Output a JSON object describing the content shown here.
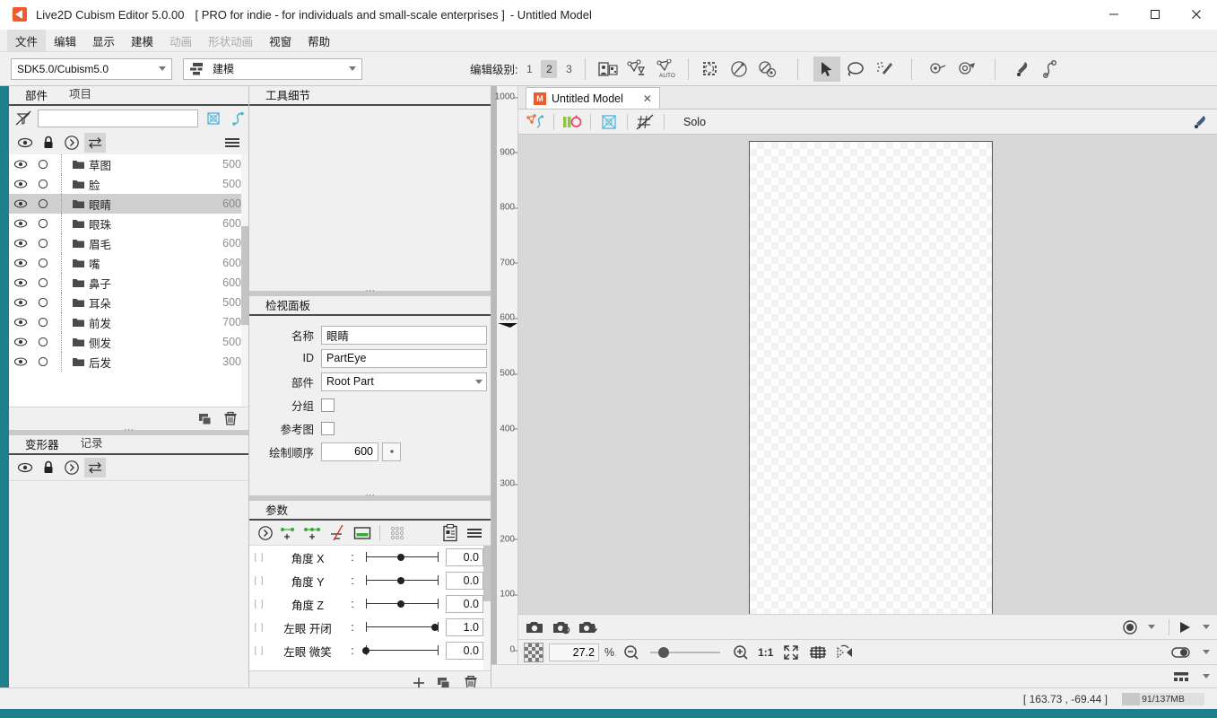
{
  "window": {
    "app_title": "Live2D Cubism Editor 5.0.00",
    "license": "[ PRO for indie - for individuals and small-scale enterprises ]",
    "document_title": "- Untitled Model",
    "minimize": "–",
    "maximize": "☐",
    "close": "✕"
  },
  "menubar": {
    "items": [
      {
        "label": "文件",
        "state": "selected"
      },
      {
        "label": "编辑",
        "state": "normal"
      },
      {
        "label": "显示",
        "state": "normal"
      },
      {
        "label": "建模",
        "state": "normal"
      },
      {
        "label": "动画",
        "state": "disabled"
      },
      {
        "label": "形状动画",
        "state": "disabled"
      },
      {
        "label": "视窗",
        "state": "normal"
      },
      {
        "label": "帮助",
        "state": "normal"
      }
    ]
  },
  "toolbar": {
    "sdk_combo_value": "SDK5.0/Cubism5.0",
    "mode_combo_value": "建模",
    "edit_level_label": "编辑级别:",
    "edit_levels": [
      "1",
      "2",
      "3"
    ],
    "edit_level_active": "2",
    "icons": [
      "texture-atlas-icon",
      "mesh-pen-icon",
      "mesh-auto-icon",
      "select-mesh-icon",
      "brush-select-icon",
      "glue-icon",
      "arrow-select-icon",
      "lasso-icon",
      "deform-brush-icon",
      "rotate-deformer-icon",
      "warp-deformer-icon",
      "art-path-icon",
      "glue-link-icon"
    ]
  },
  "parts_panel": {
    "tabs": [
      {
        "label": "部件",
        "active": true
      },
      {
        "label": "项目",
        "active": false
      }
    ],
    "search_placeholder": "",
    "search_value": "",
    "toolbar_icons": [
      "filter-off-icon",
      "mesh-icon",
      "glue-icon",
      "clip-icon",
      "target-icon",
      "art-path-icon"
    ],
    "filter_icons": [
      "eye-icon",
      "lock-icon",
      "expand-icon",
      "sync-icon"
    ],
    "menu_icon": "hamburger-icon",
    "rows": [
      {
        "name": "草图",
        "order": "500",
        "selected": false
      },
      {
        "name": "脸",
        "order": "500",
        "selected": false
      },
      {
        "name": "眼睛",
        "order": "600",
        "selected": true
      },
      {
        "name": "眼珠",
        "order": "600",
        "selected": false
      },
      {
        "name": "眉毛",
        "order": "600",
        "selected": false
      },
      {
        "name": "嘴",
        "order": "600",
        "selected": false
      },
      {
        "name": "鼻子",
        "order": "600",
        "selected": false
      },
      {
        "name": "耳朵",
        "order": "500",
        "selected": false
      },
      {
        "name": "前发",
        "order": "700",
        "selected": false
      },
      {
        "name": "侧发",
        "order": "500",
        "selected": false
      },
      {
        "name": "后发",
        "order": "300",
        "selected": false
      }
    ],
    "footer_icons": [
      "duplicate-icon",
      "delete-icon"
    ]
  },
  "deformer_panel": {
    "tabs": [
      {
        "label": "变形器",
        "active": true
      },
      {
        "label": "记录",
        "active": false
      }
    ],
    "filter_icons": [
      "eye-icon",
      "lock-icon",
      "expand-icon",
      "sync-icon"
    ]
  },
  "tool_detail": {
    "tabs": [
      {
        "label": "工具细节",
        "active": true
      }
    ]
  },
  "inspector": {
    "tabs": [
      {
        "label": "检视面板",
        "active": true
      }
    ],
    "fields": [
      {
        "label": "名称",
        "type": "text",
        "value": "眼睛"
      },
      {
        "label": "ID",
        "type": "text",
        "value": "PartEye"
      },
      {
        "label": "部件",
        "type": "combo",
        "value": "Root Part"
      },
      {
        "label": "分组",
        "type": "check",
        "value": false
      },
      {
        "label": "参考图",
        "type": "check",
        "value": false
      },
      {
        "label": "绘制顺序",
        "type": "number",
        "value": "600"
      }
    ]
  },
  "parameters": {
    "tabs": [
      {
        "label": "参数",
        "active": true
      }
    ],
    "toolbar_icons": [
      "expand-icon",
      "add-2point-icon",
      "add-3point-icon",
      "remove-point-icon",
      "keyform-icon",
      "multi-param-icon",
      "paste-param-icon",
      "hamburger-icon"
    ],
    "rows": [
      {
        "name": "角度 X",
        "value": "0.0",
        "knob_pct": 50
      },
      {
        "name": "角度 Y",
        "value": "0.0",
        "knob_pct": 50
      },
      {
        "name": "角度 Z",
        "value": "0.0",
        "knob_pct": 50
      },
      {
        "name": "左眼 开闭",
        "value": "1.0",
        "knob_pct": 100
      },
      {
        "name": "左眼 微笑",
        "value": "0.0",
        "knob_pct": 0
      }
    ],
    "footer_icons": [
      "add-icon",
      "duplicate-icon",
      "delete-icon"
    ]
  },
  "canvas": {
    "tab": {
      "label": "Untitled Model",
      "icon_letter": "M",
      "close": "✕"
    },
    "toolbar_icons": [
      "mesh-edit-icon",
      "deformer-icon",
      "keyform-icon",
      "rotate-icon",
      "texture-icon",
      "grid-off-icon"
    ],
    "solo_label": "Solo",
    "right_icon": "art-path-icon",
    "ruler_ticks": [
      "1000",
      "900",
      "800",
      "700",
      "600",
      "500",
      "400",
      "300",
      "200",
      "100",
      "0"
    ],
    "ruler_highlight": "600",
    "camera_icons": [
      "snapshot-icon",
      "snapshot-settings-icon",
      "snapshot-save-icon"
    ],
    "record_dropdown": "record-icon",
    "play_dropdown": "play-icon"
  },
  "zoombar": {
    "background_swatch": "checker-swatch",
    "zoom_value": "27.2",
    "percent_symbol": "%",
    "zoom_out_icon": "zoom-out-icon",
    "zoom_in_icon": "zoom-in-icon",
    "slider_pct": 12,
    "ratio_label": "1:1",
    "fit_icon": "fit-screen-icon",
    "grid_icon": "grid-icon",
    "flip_icon": "flip-icon",
    "onion_icon": "onion-skin-icon",
    "layout_icon": "layout-icon"
  },
  "statusbar": {
    "coordinates": "[  163.73 ,  -69.44 ]",
    "memory": "91/137MB",
    "memory_pct": 22
  },
  "colors": {
    "accent_teal": "#1f7f8c",
    "brand_orange": "#f05a28",
    "selection_gray": "#cfcfcf",
    "panel_bg": "#f0f0f0",
    "stage_bg": "#d8d8d8"
  }
}
